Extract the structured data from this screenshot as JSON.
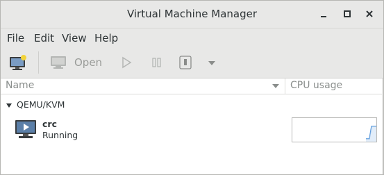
{
  "window": {
    "title": "Virtual Machine Manager"
  },
  "menubar": {
    "items": [
      "File",
      "Edit",
      "View",
      "Help"
    ]
  },
  "toolbar": {
    "new_vm_icon": "computer-new-icon",
    "open_label": "Open",
    "open_icon": "monitor-icon",
    "run_icon": "play-icon",
    "pause_icon": "pause-icon",
    "shutdown_icon": "power-icon",
    "more_icon": "dropdown-arrow-icon"
  },
  "columns": {
    "name": "Name",
    "cpu": "CPU usage"
  },
  "connection": {
    "label": "QEMU/KVM",
    "vms": [
      {
        "name": "crc",
        "status": "Running",
        "icon": "vm-monitor-icon"
      }
    ]
  },
  "colors": {
    "chrome": "#e8e8e7",
    "text": "#2e3436",
    "disabled": "#9a9c99",
    "graph_line": "#4a90d9"
  }
}
